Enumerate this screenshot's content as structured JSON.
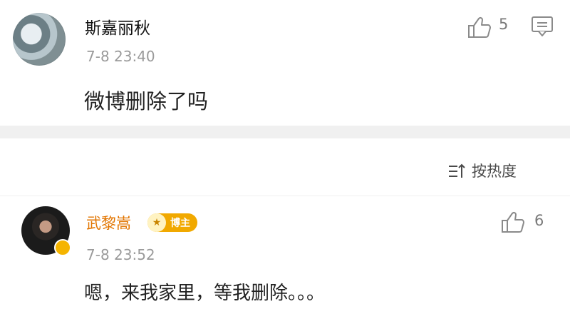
{
  "comments": [
    {
      "username": "斯嘉丽秋",
      "time": "7-8 23:40",
      "text": "微博删除了吗",
      "likes": "5"
    },
    {
      "username": "武黎嵩",
      "badge": "博主",
      "time": "7-8 23:52",
      "text": "嗯，来我家里，等我删除。。。",
      "likes": "6"
    }
  ],
  "sort": {
    "label": "按热度"
  },
  "icons": {
    "like": "thumbs-up-icon",
    "comment": "comment-icon",
    "sort": "sort-icon",
    "verified": "verified-badge-icon"
  },
  "colors": {
    "author_name": "#e27500",
    "badge": "#f1a900",
    "muted": "#9a9a9a",
    "separator": "#f0f0f0"
  }
}
